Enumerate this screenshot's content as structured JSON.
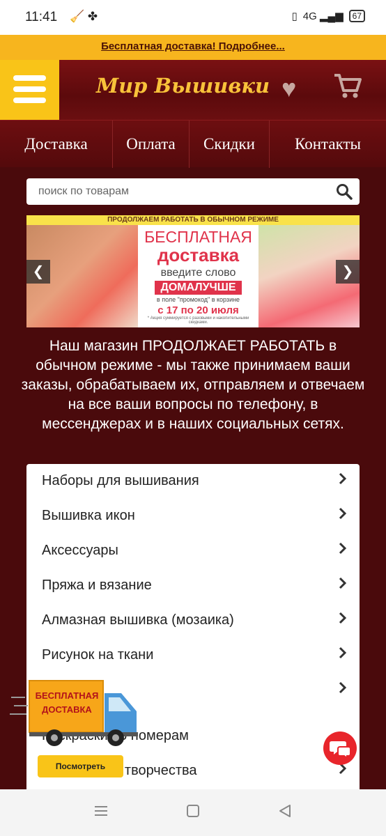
{
  "status": {
    "time": "11:41",
    "signal": "4G",
    "battery": "67"
  },
  "promo": {
    "text": "Бесплатная доставка! Подробнее..."
  },
  "header": {
    "logo": "Мир Вышивки"
  },
  "nav": [
    {
      "label": "Доставка"
    },
    {
      "label": "Оплата"
    },
    {
      "label": "Скидки"
    },
    {
      "label": "Контакты"
    }
  ],
  "search": {
    "placeholder": "поиск по товарам"
  },
  "banner": {
    "strip": "ПРОДОЛЖАЕМ РАБОТАТЬ В ОБЫЧНОМ РЕЖИМЕ",
    "line1": "БЕСПЛАТНАЯ",
    "line2": "доставка",
    "line3": "введите слово",
    "code": "ДОМАЛУЧШЕ",
    "line4": "в поле \"промокод\" в корзине",
    "dates": "с 17 по 20 июля",
    "note": "* Акция суммируется с разовыми и накопительными скидками."
  },
  "info": {
    "text": "Наш магазин ПРОДОЛЖАЕТ РАБОТАТЬ в обычном режиме - мы также принимаем ваши заказы, обрабатываем их, отправляем и отвечаем на все ваши вопросы по телефону, в мессенджерах и в наших социальных сетях."
  },
  "categories": [
    {
      "label": "Наборы для вышивания"
    },
    {
      "label": "Вышивка икон"
    },
    {
      "label": "Аксессуары"
    },
    {
      "label": "Пряжа и вязание"
    },
    {
      "label": "Алмазная вышивка (мозаика)"
    },
    {
      "label": "Рисунок на ткани"
    },
    {
      "label": ""
    },
    {
      "label": "Раскраски по номерам"
    },
    {
      "label": "Наборы для творчества"
    }
  ],
  "truck": {
    "text_line1": "БЕСПЛАТНАЯ",
    "text_line2": "ДОСТАВКА"
  },
  "watch_button": {
    "label": "Посмотреть"
  },
  "colors": {
    "promo_bar": "#f7b51e",
    "header": "#6b0f11",
    "menu_button": "#f9c418",
    "logo": "#f8c23a",
    "banner_accent": "#e0334b",
    "chat": "#e8252b"
  }
}
